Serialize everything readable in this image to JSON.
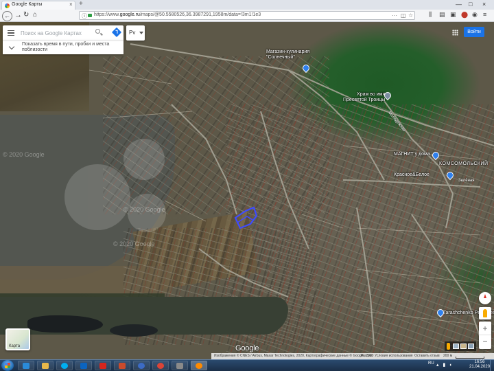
{
  "browser": {
    "tab_title": "Google Карты",
    "tab_close": "×",
    "new_tab": "+",
    "url_prefix": "https://www.",
    "url_domain": "google.ru",
    "url_rest": "/maps/@50.5580526,36.3987291,1958m/data=!3m1!1e3",
    "window_controls": [
      "—",
      "□",
      "×"
    ]
  },
  "search": {
    "placeholder": "Поиск на Google Картах",
    "value": ""
  },
  "hint": {
    "text": "Показать время в пути, пробки и места поблизости"
  },
  "layers_button": {
    "label": "Рv"
  },
  "signin": {
    "label": "Войти"
  },
  "map": {
    "type": "satellite",
    "watermark_text": "© 2020 Google",
    "places": [
      {
        "label": "Магазин-кулинария\n\"Солнечный\"",
        "pin": "blue"
      },
      {
        "label": "Храм во имя\nПресвятой Троицы",
        "pin": "gray"
      },
      {
        "label": "МАГНИТ у дома",
        "pin": "blue"
      },
      {
        "label": "Красное&Белое",
        "pin": "blue"
      },
      {
        "label": "КОМСОМОЛЬСКИЙ",
        "pin": ""
      },
      {
        "label": "Tarashchenko Perfumes",
        "pin": "blue"
      }
    ],
    "road_labels": [
      "Зелёная",
      "Молодёжная"
    ],
    "layer_thumb_label": "Карта",
    "google_logo": "Google",
    "zoom_in": "+",
    "zoom_out": "−",
    "footer": [
      "Изображения © CNES / Airbus, Maxar Technologies, 2020, Картографические данные © Google, 2020",
      "Россия",
      "Условия использования",
      "Оставить отзыв",
      "200 м"
    ]
  },
  "taskbar": {
    "language": "RU",
    "time": "16:56",
    "date": "21.04.2020",
    "apps": [
      {
        "name": "ie",
        "color": "#2a8bd8"
      },
      {
        "name": "explorer",
        "color": "#e8b84a"
      },
      {
        "name": "skype",
        "color": "#00aff0"
      },
      {
        "name": "outlook",
        "color": "#0b64c0"
      },
      {
        "name": "acrobat",
        "color": "#d7261d"
      },
      {
        "name": "app-red",
        "color": "#c94b2c"
      },
      {
        "name": "app-blue-circle",
        "color": "#3c6bc4"
      },
      {
        "name": "chrome",
        "color": "#db4437"
      },
      {
        "name": "photos",
        "color": "#8a8a8a"
      },
      {
        "name": "firefox",
        "color": "#ff8a00"
      }
    ]
  }
}
